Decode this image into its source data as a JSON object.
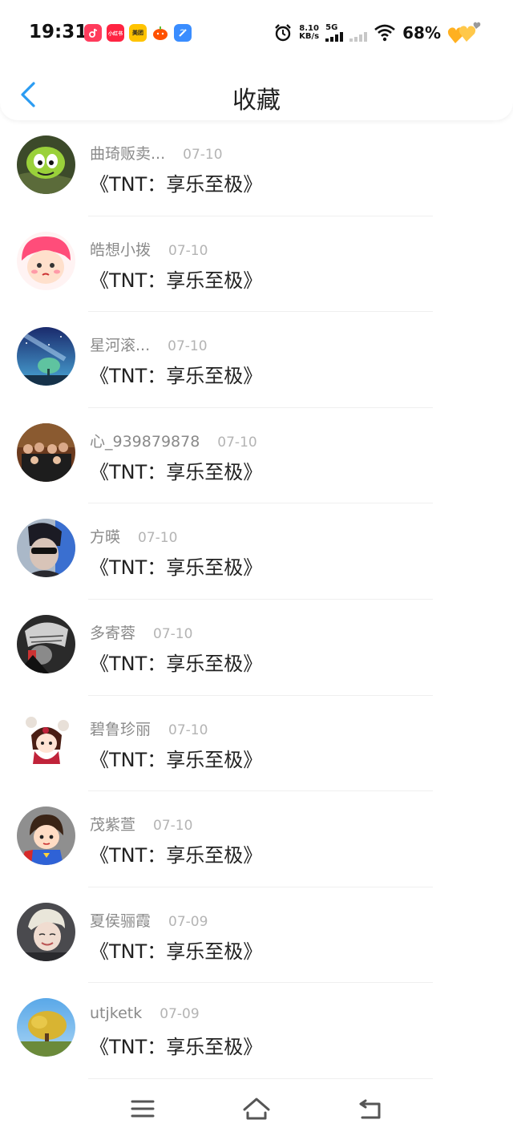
{
  "status_bar": {
    "time": "19:31",
    "apps": [
      {
        "icon": "douyin-app-icon",
        "label": "",
        "color": "#ff3b5c"
      },
      {
        "icon": "xiaohongshu-app-icon",
        "label": "小红书",
        "color": "#ff2442"
      },
      {
        "icon": "meituan-app-icon",
        "label": "美团",
        "color": "#ffc300"
      },
      {
        "icon": "taobao-app-icon",
        "label": "",
        "color": "#ff5000"
      },
      {
        "icon": "browser-app-icon",
        "label": "",
        "color": "#3a8dff"
      }
    ],
    "alarm_icon": "alarm-clock-icon",
    "speed_value": "8.10",
    "speed_unit": "KB/s",
    "network": "5G",
    "battery_percent": "68%"
  },
  "header": {
    "back_icon": "chevron-left-icon",
    "title": "收藏",
    "accent_color": "#2b9cf2"
  },
  "items": [
    {
      "username": "曲琦贩卖...",
      "date": "07-10",
      "title": "《TNT：享乐至极》",
      "avatar": "cartoon-green-avatar"
    },
    {
      "username": "皓想小拨",
      "date": "07-10",
      "title": "《TNT：享乐至极》",
      "avatar": "cartoon-girl-avatar"
    },
    {
      "username": "星河滚...",
      "date": "07-10",
      "title": "《TNT：享乐至极》",
      "avatar": "starry-tree-avatar"
    },
    {
      "username": "心_939879878",
      "date": "07-10",
      "title": "《TNT：享乐至极》",
      "avatar": "group-photo-avatar"
    },
    {
      "username": "方暎",
      "date": "07-10",
      "title": "《TNT：享乐至极》",
      "avatar": "sunglasses-man-avatar"
    },
    {
      "username": "多寄蓉",
      "date": "07-10",
      "title": "《TNT：享乐至极》",
      "avatar": "monochrome-art-avatar"
    },
    {
      "username": "碧鲁珍丽",
      "date": "07-10",
      "title": "《TNT：享乐至极》",
      "avatar": "anime-doll-avatar"
    },
    {
      "username": "茂紫萱",
      "date": "07-10",
      "title": "《TNT：享乐至极》",
      "avatar": "superhero-girl-avatar"
    },
    {
      "username": "夏侯骊霞",
      "date": "07-09",
      "title": "《TNT：享乐至极》",
      "avatar": "blond-person-avatar"
    },
    {
      "username": "utjketk",
      "date": "07-09",
      "title": "《TNT：享乐至极》",
      "avatar": "autumn-tree-avatar"
    }
  ],
  "bottom_nav": {
    "menu_icon": "menu-icon",
    "home_icon": "home-icon",
    "back_icon": "return-icon"
  }
}
